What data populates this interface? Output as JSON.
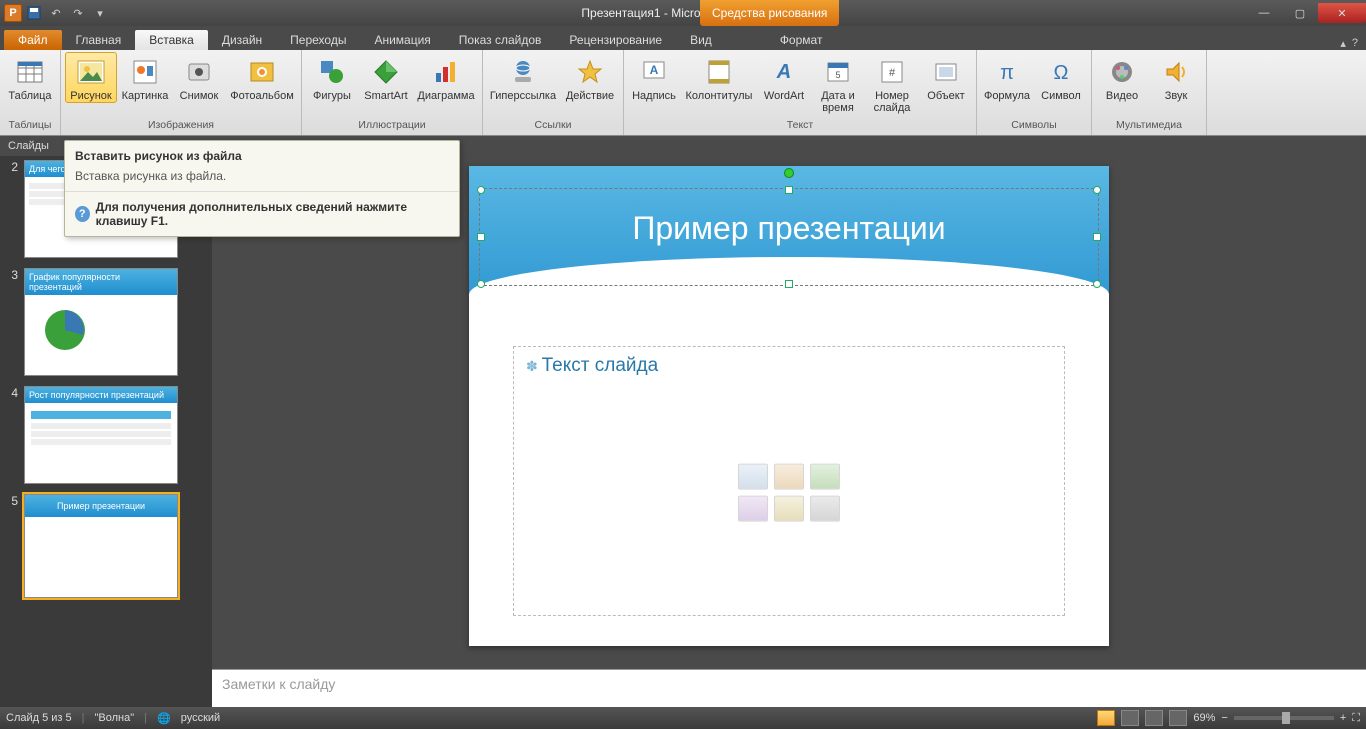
{
  "titlebar": {
    "doc_title": "Презентация1 - Microsoft PowerPoint",
    "context_tools": "Средства рисования"
  },
  "tabs": {
    "file": "Файл",
    "items": [
      "Главная",
      "Вставка",
      "Дизайн",
      "Переходы",
      "Анимация",
      "Показ слайдов",
      "Рецензирование",
      "Вид"
    ],
    "active_index": 1,
    "context_tab": "Формат"
  },
  "ribbon": {
    "groups": [
      {
        "label": "Таблицы",
        "btns": [
          {
            "name": "Таблица",
            "icon": "table"
          }
        ]
      },
      {
        "label": "Изображения",
        "btns": [
          {
            "name": "Рисунок",
            "icon": "picture",
            "sel": true
          },
          {
            "name": "Картинка",
            "icon": "clipart"
          },
          {
            "name": "Снимок",
            "icon": "screenshot"
          },
          {
            "name": "Фотоальбом",
            "icon": "album"
          }
        ]
      },
      {
        "label": "Иллюстрации",
        "btns": [
          {
            "name": "Фигуры",
            "icon": "shapes"
          },
          {
            "name": "SmartArt",
            "icon": "smartart"
          },
          {
            "name": "Диаграмма",
            "icon": "chart"
          }
        ]
      },
      {
        "label": "Ссылки",
        "btns": [
          {
            "name": "Гиперссылка",
            "icon": "link"
          },
          {
            "name": "Действие",
            "icon": "action"
          }
        ]
      },
      {
        "label": "Текст",
        "btns": [
          {
            "name": "Надпись",
            "icon": "textbox"
          },
          {
            "name": "Колонтитулы",
            "icon": "headerfooter"
          },
          {
            "name": "WordArt",
            "icon": "wordart"
          },
          {
            "name": "Дата и время",
            "icon": "datetime"
          },
          {
            "name": "Номер слайда",
            "icon": "slidenum"
          },
          {
            "name": "Объект",
            "icon": "object"
          }
        ]
      },
      {
        "label": "Символы",
        "btns": [
          {
            "name": "Формула",
            "icon": "equation"
          },
          {
            "name": "Символ",
            "icon": "symbol"
          }
        ]
      },
      {
        "label": "Мультимедиа",
        "btns": [
          {
            "name": "Видео",
            "icon": "video"
          },
          {
            "name": "Звук",
            "icon": "audio"
          }
        ]
      }
    ]
  },
  "tooltip": {
    "title": "Вставить рисунок из файла",
    "body": "Вставка рисунка из файла.",
    "help": "Для получения дополнительных сведений нажмите клавишу F1."
  },
  "sidebar": {
    "tab_label": "Слайды",
    "thumbs": [
      {
        "num": "2",
        "title": "Для чего нужны презентации"
      },
      {
        "num": "3",
        "title": "График популярности презентаций"
      },
      {
        "num": "4",
        "title": "Рост популярности презентаций"
      },
      {
        "num": "5",
        "title": "Пример презентации",
        "selected": true
      }
    ]
  },
  "slide": {
    "title_text": "Пример презентации",
    "content_placeholder": "Текст слайда"
  },
  "notes_placeholder": "Заметки к слайду",
  "statusbar": {
    "slide_info": "Слайд 5 из 5",
    "theme": "\"Волна\"",
    "language": "русский",
    "zoom": "69%"
  }
}
